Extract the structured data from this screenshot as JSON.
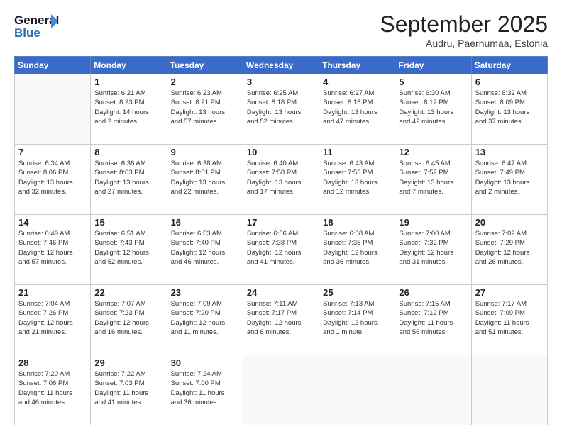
{
  "logo": {
    "line1": "General",
    "line2": "Blue"
  },
  "title": "September 2025",
  "location": "Audru, Paernumaa, Estonia",
  "weekdays": [
    "Sunday",
    "Monday",
    "Tuesday",
    "Wednesday",
    "Thursday",
    "Friday",
    "Saturday"
  ],
  "weeks": [
    [
      {
        "day": "",
        "info": ""
      },
      {
        "day": "1",
        "info": "Sunrise: 6:21 AM\nSunset: 8:23 PM\nDaylight: 14 hours\nand 2 minutes."
      },
      {
        "day": "2",
        "info": "Sunrise: 6:23 AM\nSunset: 8:21 PM\nDaylight: 13 hours\nand 57 minutes."
      },
      {
        "day": "3",
        "info": "Sunrise: 6:25 AM\nSunset: 8:18 PM\nDaylight: 13 hours\nand 52 minutes."
      },
      {
        "day": "4",
        "info": "Sunrise: 6:27 AM\nSunset: 8:15 PM\nDaylight: 13 hours\nand 47 minutes."
      },
      {
        "day": "5",
        "info": "Sunrise: 6:30 AM\nSunset: 8:12 PM\nDaylight: 13 hours\nand 42 minutes."
      },
      {
        "day": "6",
        "info": "Sunrise: 6:32 AM\nSunset: 8:09 PM\nDaylight: 13 hours\nand 37 minutes."
      }
    ],
    [
      {
        "day": "7",
        "info": "Sunrise: 6:34 AM\nSunset: 8:06 PM\nDaylight: 13 hours\nand 32 minutes."
      },
      {
        "day": "8",
        "info": "Sunrise: 6:36 AM\nSunset: 8:03 PM\nDaylight: 13 hours\nand 27 minutes."
      },
      {
        "day": "9",
        "info": "Sunrise: 6:38 AM\nSunset: 8:01 PM\nDaylight: 13 hours\nand 22 minutes."
      },
      {
        "day": "10",
        "info": "Sunrise: 6:40 AM\nSunset: 7:58 PM\nDaylight: 13 hours\nand 17 minutes."
      },
      {
        "day": "11",
        "info": "Sunrise: 6:43 AM\nSunset: 7:55 PM\nDaylight: 13 hours\nand 12 minutes."
      },
      {
        "day": "12",
        "info": "Sunrise: 6:45 AM\nSunset: 7:52 PM\nDaylight: 13 hours\nand 7 minutes."
      },
      {
        "day": "13",
        "info": "Sunrise: 6:47 AM\nSunset: 7:49 PM\nDaylight: 13 hours\nand 2 minutes."
      }
    ],
    [
      {
        "day": "14",
        "info": "Sunrise: 6:49 AM\nSunset: 7:46 PM\nDaylight: 12 hours\nand 57 minutes."
      },
      {
        "day": "15",
        "info": "Sunrise: 6:51 AM\nSunset: 7:43 PM\nDaylight: 12 hours\nand 52 minutes."
      },
      {
        "day": "16",
        "info": "Sunrise: 6:53 AM\nSunset: 7:40 PM\nDaylight: 12 hours\nand 46 minutes."
      },
      {
        "day": "17",
        "info": "Sunrise: 6:56 AM\nSunset: 7:38 PM\nDaylight: 12 hours\nand 41 minutes."
      },
      {
        "day": "18",
        "info": "Sunrise: 6:58 AM\nSunset: 7:35 PM\nDaylight: 12 hours\nand 36 minutes."
      },
      {
        "day": "19",
        "info": "Sunrise: 7:00 AM\nSunset: 7:32 PM\nDaylight: 12 hours\nand 31 minutes."
      },
      {
        "day": "20",
        "info": "Sunrise: 7:02 AM\nSunset: 7:29 PM\nDaylight: 12 hours\nand 26 minutes."
      }
    ],
    [
      {
        "day": "21",
        "info": "Sunrise: 7:04 AM\nSunset: 7:26 PM\nDaylight: 12 hours\nand 21 minutes."
      },
      {
        "day": "22",
        "info": "Sunrise: 7:07 AM\nSunset: 7:23 PM\nDaylight: 12 hours\nand 16 minutes."
      },
      {
        "day": "23",
        "info": "Sunrise: 7:09 AM\nSunset: 7:20 PM\nDaylight: 12 hours\nand 11 minutes."
      },
      {
        "day": "24",
        "info": "Sunrise: 7:11 AM\nSunset: 7:17 PM\nDaylight: 12 hours\nand 6 minutes."
      },
      {
        "day": "25",
        "info": "Sunrise: 7:13 AM\nSunset: 7:14 PM\nDaylight: 12 hours\nand 1 minute."
      },
      {
        "day": "26",
        "info": "Sunrise: 7:15 AM\nSunset: 7:12 PM\nDaylight: 11 hours\nand 56 minutes."
      },
      {
        "day": "27",
        "info": "Sunrise: 7:17 AM\nSunset: 7:09 PM\nDaylight: 11 hours\nand 51 minutes."
      }
    ],
    [
      {
        "day": "28",
        "info": "Sunrise: 7:20 AM\nSunset: 7:06 PM\nDaylight: 11 hours\nand 46 minutes."
      },
      {
        "day": "29",
        "info": "Sunrise: 7:22 AM\nSunset: 7:03 PM\nDaylight: 11 hours\nand 41 minutes."
      },
      {
        "day": "30",
        "info": "Sunrise: 7:24 AM\nSunset: 7:00 PM\nDaylight: 11 hours\nand 36 minutes."
      },
      {
        "day": "",
        "info": ""
      },
      {
        "day": "",
        "info": ""
      },
      {
        "day": "",
        "info": ""
      },
      {
        "day": "",
        "info": ""
      }
    ]
  ]
}
